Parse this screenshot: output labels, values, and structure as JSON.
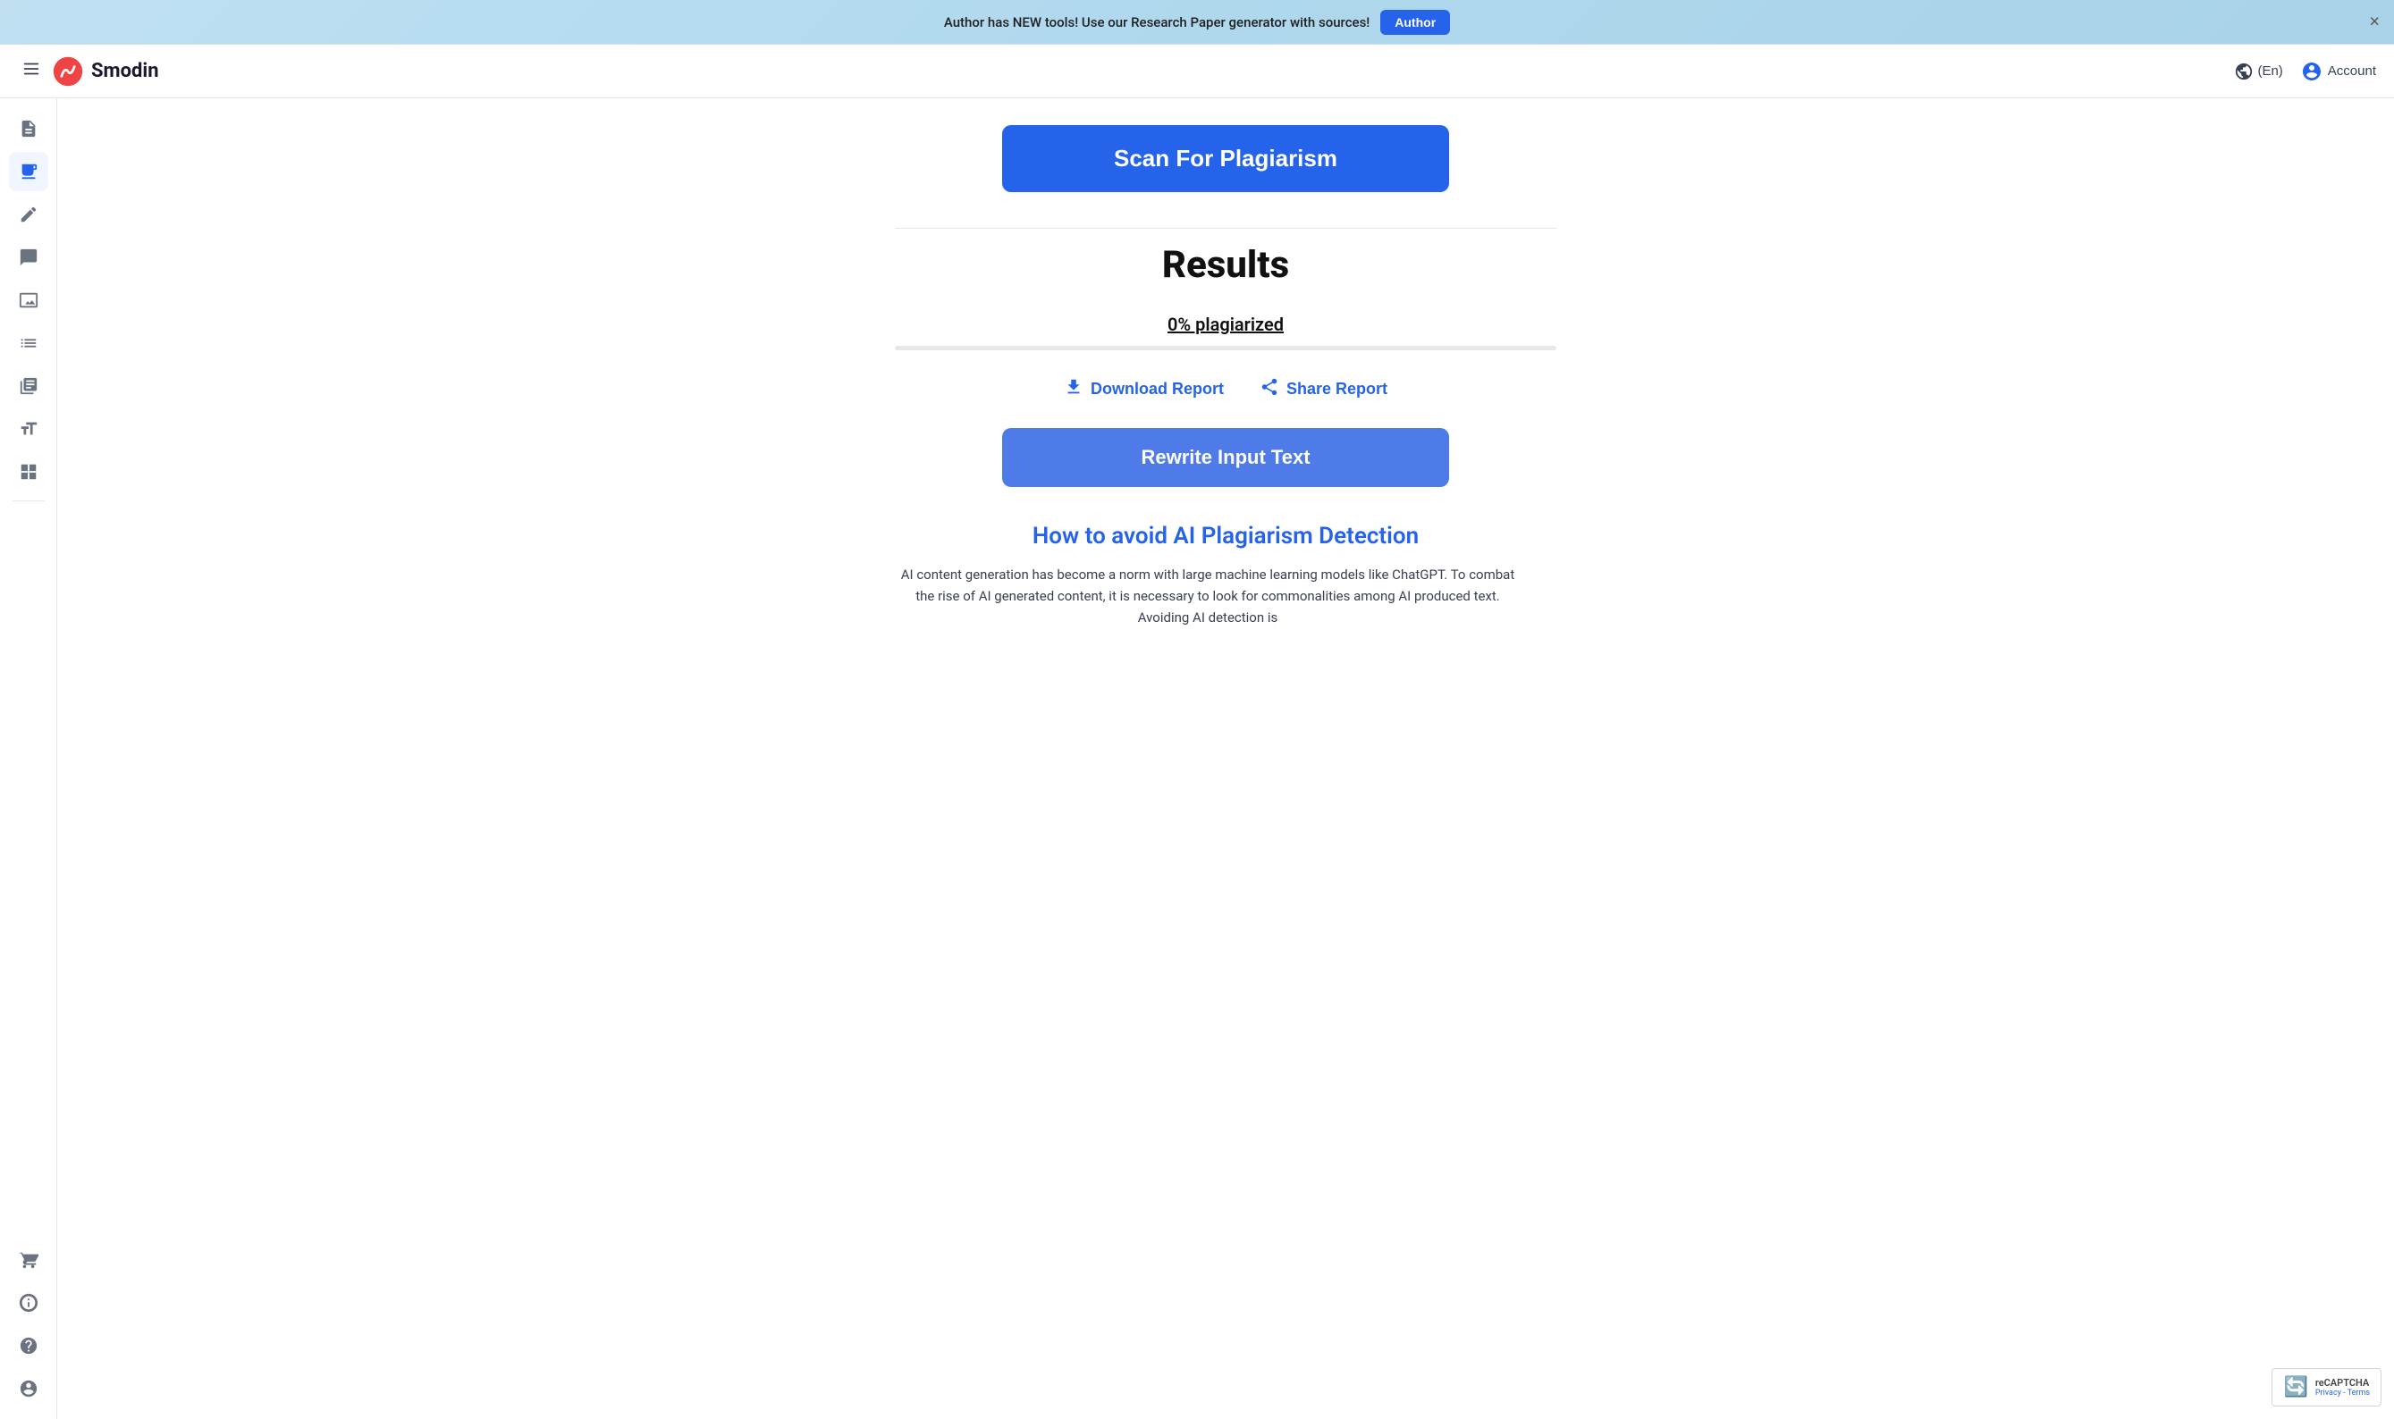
{
  "announcement": {
    "text": "Author has NEW tools! Use our Research Paper generator with sources!",
    "button_label": "Author",
    "close_label": "×"
  },
  "header": {
    "logo_text": "Smodin",
    "language": "(En)",
    "account_label": "Account"
  },
  "sidebar": {
    "items": [
      {
        "name": "document-icon",
        "label": "Document",
        "active": false
      },
      {
        "name": "plagiarism-icon",
        "label": "Plagiarism",
        "active": true
      },
      {
        "name": "edit-icon",
        "label": "Edit",
        "active": false
      },
      {
        "name": "chat-icon",
        "label": "Chat",
        "active": false
      },
      {
        "name": "image-icon",
        "label": "Image",
        "active": false
      },
      {
        "name": "list-icon",
        "label": "List",
        "active": false
      },
      {
        "name": "books-icon",
        "label": "Books",
        "active": false
      },
      {
        "name": "font-icon",
        "label": "Font",
        "active": false
      },
      {
        "name": "grid-icon",
        "label": "Grid",
        "active": false
      }
    ],
    "bottom_items": [
      {
        "name": "cart-icon",
        "label": "Cart"
      },
      {
        "name": "support-icon",
        "label": "Support"
      },
      {
        "name": "help-icon",
        "label": "Help"
      },
      {
        "name": "profile-icon",
        "label": "Profile"
      }
    ]
  },
  "main": {
    "scan_button_label": "Scan For Plagiarism",
    "results_title": "Results",
    "plagiarism_percent": "0% plagiarized",
    "progress_value": 0,
    "download_report_label": "Download Report",
    "share_report_label": "Share Report",
    "rewrite_button_label": "Rewrite Input Text",
    "avoid_title": "How to avoid AI Plagiarism Detection",
    "avoid_text": "AI content generation has become a norm with large machine learning models like ChatGPT. To combat the rise of AI generated content, it is necessary to look for commonalities among AI produced text. Avoiding AI detection is"
  },
  "recaptcha": {
    "label": "reCAPTCHA",
    "privacy": "Privacy - Terms"
  }
}
